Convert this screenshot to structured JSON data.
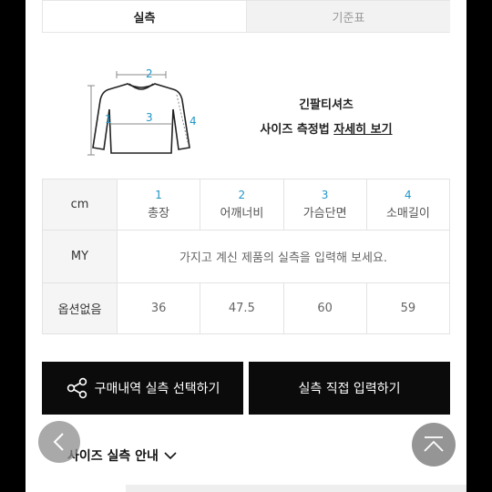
{
  "tabs": [
    {
      "label": "실측"
    },
    {
      "label": "기준표"
    }
  ],
  "diagram": {
    "labels": [
      "1",
      "2",
      "3",
      "4"
    ]
  },
  "heading": {
    "title": "긴팔티셔츠",
    "subtitle_prefix": "사이즈 측정법 ",
    "subtitle_link": "자세히 보기"
  },
  "table": {
    "unit": "cm",
    "columns": [
      {
        "num": "1",
        "name": "총장"
      },
      {
        "num": "2",
        "name": "어깨너비"
      },
      {
        "num": "3",
        "name": "가슴단면"
      },
      {
        "num": "4",
        "name": "소매길이"
      }
    ],
    "my_label": "MY",
    "my_hint": "가지고 계신 제품의 실측을 입력해 보세요.",
    "option_label": "옵션없음",
    "option_values": [
      "36",
      "47.5",
      "60",
      "59"
    ]
  },
  "buttons": {
    "purchase_select": "구매내역 실측 선택하기",
    "direct_input": "실측 직접 입력하기"
  },
  "guide": {
    "label": "사이즈 실측 안내"
  },
  "colors": {
    "accent": "#2196c8",
    "button_bg": "#0b0b0b"
  }
}
